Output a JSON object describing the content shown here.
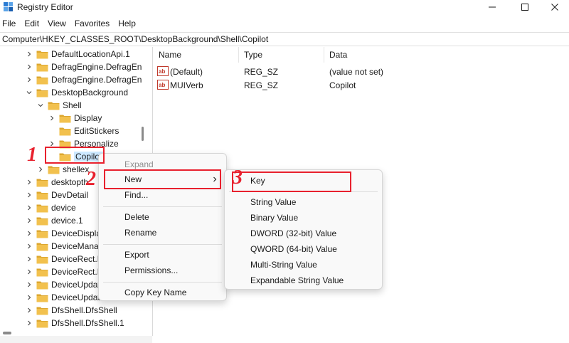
{
  "window": {
    "title": "Registry Editor",
    "icon": "registry-editor-icon"
  },
  "menu": [
    "File",
    "Edit",
    "View",
    "Favorites",
    "Help"
  ],
  "address": "Computer\\HKEY_CLASSES_ROOT\\DesktopBackground\\Shell\\Copilot",
  "tree": [
    {
      "label": "DefaultLocationApi.1",
      "level": 0,
      "expander": "collapsed"
    },
    {
      "label": "DefragEngine.DefragEn",
      "level": 0,
      "expander": "collapsed"
    },
    {
      "label": "DefragEngine.DefragEn",
      "level": 0,
      "expander": "collapsed"
    },
    {
      "label": "DesktopBackground",
      "level": 0,
      "expander": "expanded"
    },
    {
      "label": "Shell",
      "level": 1,
      "expander": "expanded"
    },
    {
      "label": "Display",
      "level": 2,
      "expander": "collapsed"
    },
    {
      "label": "EditStickers",
      "level": 2,
      "expander": "none"
    },
    {
      "label": "Personalize",
      "level": 2,
      "expander": "collapsed"
    },
    {
      "label": "Copilot",
      "level": 2,
      "expander": "none",
      "selected": true
    },
    {
      "label": "shellex",
      "level": 1,
      "expander": "collapsed"
    },
    {
      "label": "desktopth",
      "level": 0,
      "expander": "collapsed"
    },
    {
      "label": "DevDetail",
      "level": 0,
      "expander": "collapsed"
    },
    {
      "label": "device",
      "level": 0,
      "expander": "collapsed"
    },
    {
      "label": "device.1",
      "level": 0,
      "expander": "collapsed"
    },
    {
      "label": "DeviceDisplay",
      "level": 0,
      "expander": "collapsed"
    },
    {
      "label": "DeviceManag",
      "level": 0,
      "expander": "collapsed"
    },
    {
      "label": "DeviceRect.D",
      "level": 0,
      "expander": "collapsed"
    },
    {
      "label": "DeviceRect.D",
      "level": 0,
      "expander": "collapsed"
    },
    {
      "label": "DeviceUpdat",
      "level": 0,
      "expander": "collapsed"
    },
    {
      "label": "DeviceUpdat",
      "level": 0,
      "expander": "collapsed"
    },
    {
      "label": "DfsShell.DfsShell",
      "level": 0,
      "expander": "collapsed"
    },
    {
      "label": "DfsShell.DfsShell.1",
      "level": 0,
      "expander": "collapsed"
    }
  ],
  "values_panel": {
    "columns": [
      "Name",
      "Type",
      "Data"
    ],
    "rows": [
      {
        "name": "(Default)",
        "type": "REG_SZ",
        "data": "(value not set)",
        "icon": "string-value-icon"
      },
      {
        "name": "MUIVerb",
        "type": "REG_SZ",
        "data": "Copilot",
        "icon": "string-value-icon"
      }
    ]
  },
  "context_menu": {
    "items": [
      {
        "label": "Expand",
        "disabled": true
      },
      {
        "label": "New",
        "submenu": true,
        "highlighted": true
      },
      {
        "label": "Find..."
      },
      {
        "separator": true
      },
      {
        "label": "Delete"
      },
      {
        "label": "Rename"
      },
      {
        "separator": true
      },
      {
        "label": "Export"
      },
      {
        "label": "Permissions..."
      },
      {
        "separator": true
      },
      {
        "label": "Copy Key Name"
      }
    ]
  },
  "submenu": {
    "items": [
      {
        "label": "Key",
        "highlighted": true
      },
      {
        "separator": true
      },
      {
        "label": "String Value"
      },
      {
        "label": "Binary Value"
      },
      {
        "label": "DWORD (32-bit) Value"
      },
      {
        "label": "QWORD (64-bit) Value"
      },
      {
        "label": "Multi-String Value"
      },
      {
        "label": "Expandable String Value"
      }
    ]
  },
  "annotations": {
    "step1": "1",
    "step2": "2",
    "step3": "3",
    "color": "#e8212e"
  },
  "colors": {
    "folder": "#f2c14e",
    "folder_dark": "#dca730",
    "selection": "#cce8ff"
  }
}
